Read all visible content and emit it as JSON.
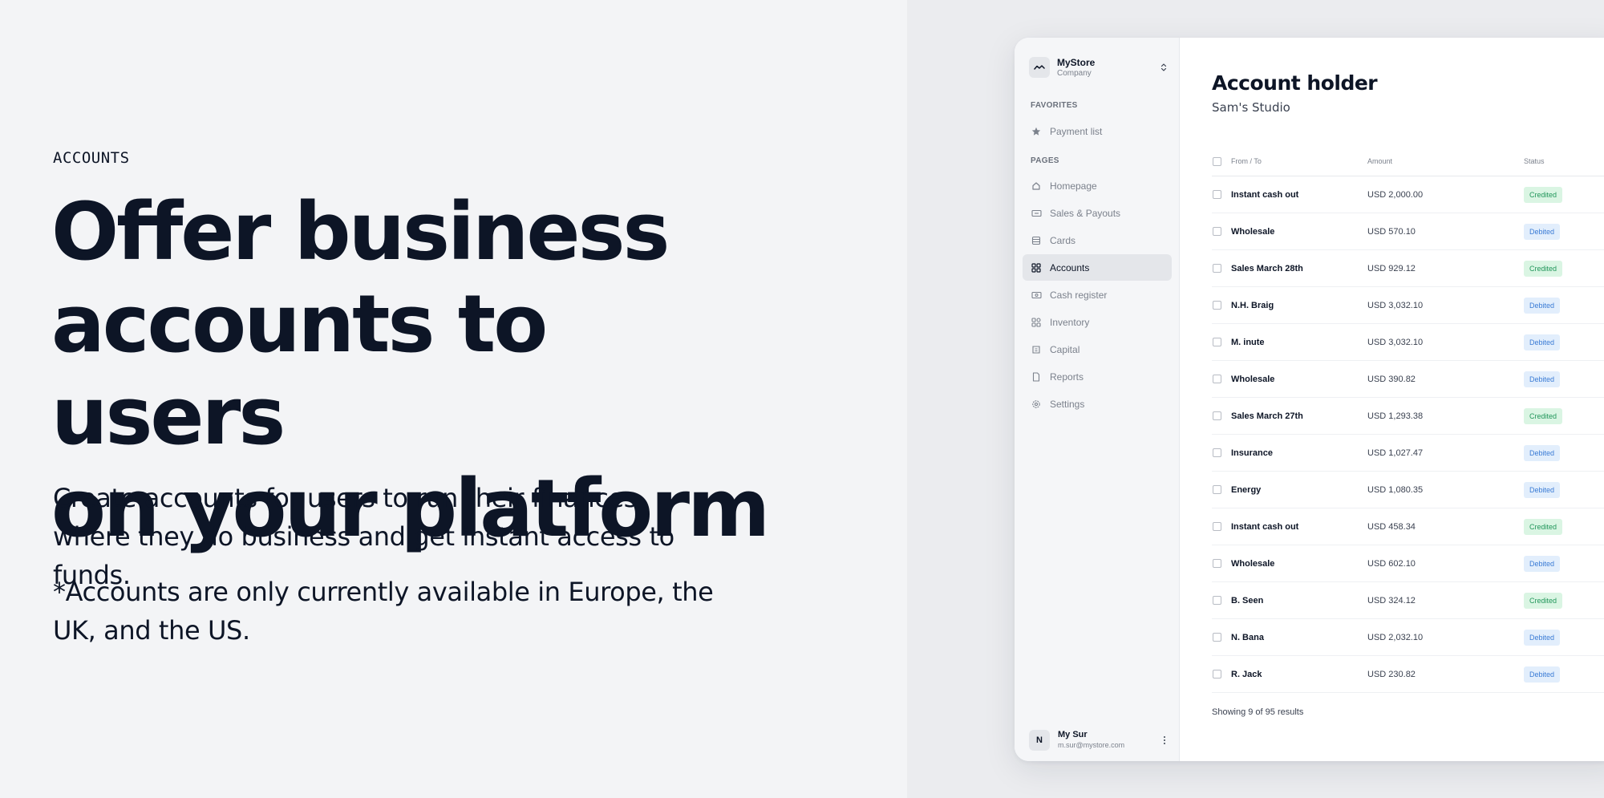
{
  "hero": {
    "eyebrow": "ACCOUNTS",
    "headline": [
      "Offer business",
      "accounts to users",
      "on your platform"
    ],
    "subtext": "Create accounts for users to run their finances where they do business and get instant access to funds.",
    "footnote": "*Accounts are only currently available in Europe, the UK, and the US."
  },
  "sidebar": {
    "store_name": "MyStore",
    "store_type": "Company",
    "favorites_label": "FAVORITES",
    "favorites": [
      {
        "label": "Payment list",
        "icon": "star-icon"
      }
    ],
    "pages_label": "PAGES",
    "items": [
      {
        "label": "Homepage",
        "icon": "home-icon"
      },
      {
        "label": "Sales & Payouts",
        "icon": "payouts-icon"
      },
      {
        "label": "Cards",
        "icon": "card-icon"
      },
      {
        "label": "Accounts",
        "icon": "grid-icon",
        "active": true
      },
      {
        "label": "Cash register",
        "icon": "cash-register-icon"
      },
      {
        "label": "Inventory",
        "icon": "inventory-icon"
      },
      {
        "label": "Capital",
        "icon": "capital-icon"
      },
      {
        "label": "Reports",
        "icon": "document-icon"
      },
      {
        "label": "Settings",
        "icon": "gear-icon"
      }
    ],
    "user": {
      "initial": "N",
      "name": "My Sur",
      "email": "m.sur@mystore.com"
    }
  },
  "main": {
    "title": "Account holder",
    "subtitle": "Sam's Studio",
    "columns": [
      "From / To",
      "Amount",
      "Status"
    ],
    "rows": [
      {
        "from": "Instant cash out",
        "amount": "USD 2,000.00",
        "status": "Credited"
      },
      {
        "from": "Wholesale",
        "amount": "USD 570.10",
        "status": "Debited"
      },
      {
        "from": "Sales March 28th",
        "amount": "USD 929.12",
        "status": "Credited"
      },
      {
        "from": "N.H. Braig",
        "amount": "USD 3,032.10",
        "status": "Debited"
      },
      {
        "from": "M. inute",
        "amount": "USD 3,032.10",
        "status": "Debited"
      },
      {
        "from": "Wholesale",
        "amount": "USD 390.82",
        "status": "Debited"
      },
      {
        "from": "Sales March 27th",
        "amount": "USD 1,293.38",
        "status": "Credited"
      },
      {
        "from": "Insurance",
        "amount": "USD 1,027.47",
        "status": "Debited"
      },
      {
        "from": "Energy",
        "amount": "USD 1,080.35",
        "status": "Debited"
      },
      {
        "from": "Instant cash out",
        "amount": "USD 458.34",
        "status": "Credited"
      },
      {
        "from": "Wholesale",
        "amount": "USD 602.10",
        "status": "Debited"
      },
      {
        "from": "B. Seen",
        "amount": "USD 324.12",
        "status": "Credited"
      },
      {
        "from": "N. Bana",
        "amount": "USD 2,032.10",
        "status": "Debited"
      },
      {
        "from": "R. Jack",
        "amount": "USD 230.82",
        "status": "Debited"
      }
    ],
    "results_text": "Showing 9 of 95 results"
  },
  "colors": {
    "text": "#0d1526",
    "credited": "#21965a",
    "debited": "#3a7bd5",
    "page_bg": "#f3f4f6"
  }
}
